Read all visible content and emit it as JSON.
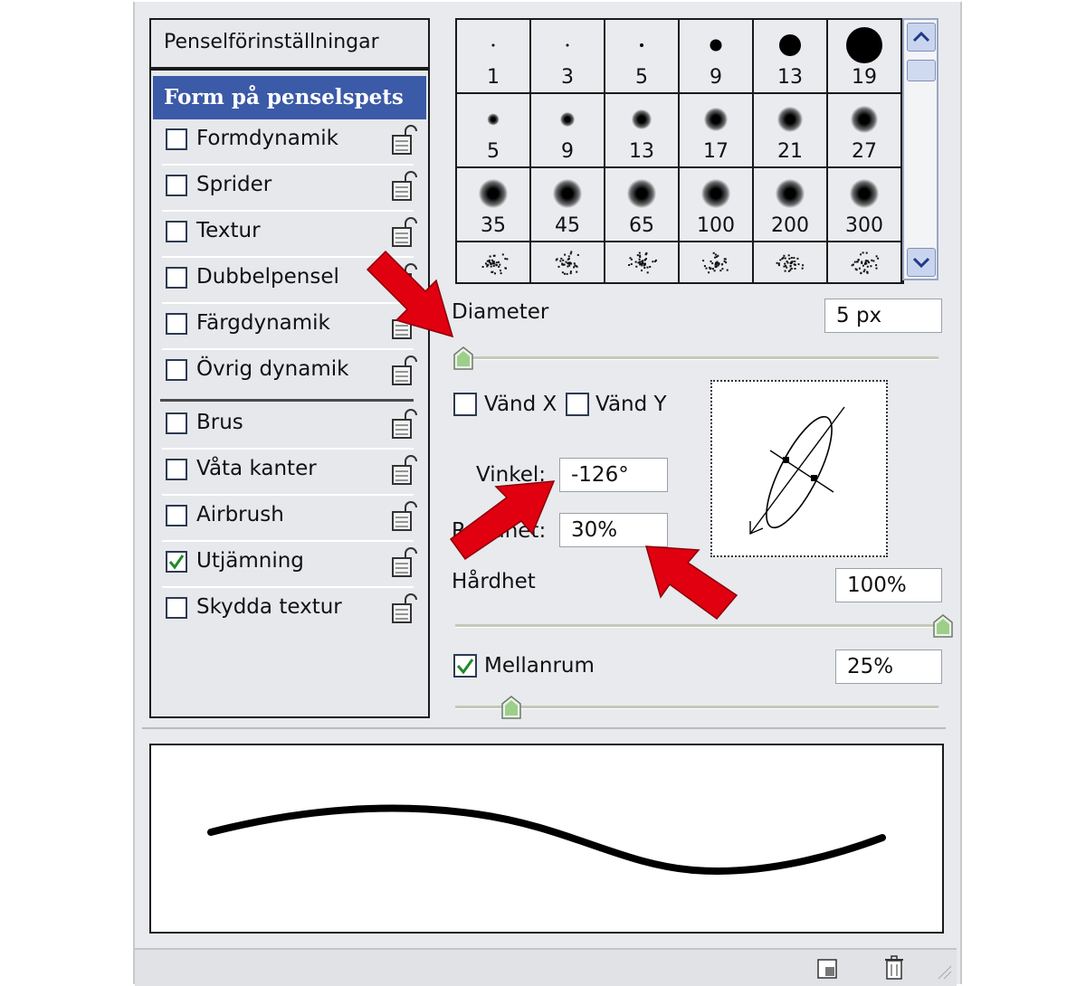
{
  "left_panel": {
    "title": "Penselförinställningar",
    "selected": "Form på penselspets",
    "items": [
      {
        "label": "Formdynamik",
        "checked": false
      },
      {
        "label": "Sprider",
        "checked": false
      },
      {
        "label": "Textur",
        "checked": false
      },
      {
        "label": "Dubbelpensel",
        "checked": false
      },
      {
        "label": "Färgdynamik",
        "checked": false
      },
      {
        "label": "Övrig dynamik",
        "checked": false
      },
      {
        "label": "Brus",
        "checked": false
      },
      {
        "label": "Våta kanter",
        "checked": false
      },
      {
        "label": "Airbrush",
        "checked": false
      },
      {
        "label": "Utjämning",
        "checked": true
      },
      {
        "label": "Skydda textur",
        "checked": false
      }
    ]
  },
  "brushes": {
    "row1": [
      "1",
      "3",
      "5",
      "9",
      "13",
      "19"
    ],
    "row2": [
      "5",
      "9",
      "13",
      "17",
      "21",
      "27"
    ],
    "row3": [
      "35",
      "45",
      "65",
      "100",
      "200",
      "300"
    ]
  },
  "diameter": {
    "label": "Diameter",
    "value": "5 px",
    "slider_fraction": 0.0
  },
  "flip": {
    "x_label": "Vänd X",
    "y_label": "Vänd Y",
    "x_checked": false,
    "y_checked": false
  },
  "angle": {
    "label": "Vinkel:",
    "value": "-126°"
  },
  "roundness": {
    "label": "Rundhet:",
    "value": "30%"
  },
  "hardness": {
    "label": "Hårdhet",
    "value": "100%",
    "slider_fraction": 1.0
  },
  "spacing": {
    "label": "Mellanrum",
    "value": "25%",
    "checked": true,
    "slider_fraction": 0.12
  },
  "icons": {
    "lock": "lock-icon",
    "new": "new-preset-icon",
    "trash": "trash-icon",
    "arrow_color": "#e00010",
    "selected_color": "#3b5aa7"
  }
}
